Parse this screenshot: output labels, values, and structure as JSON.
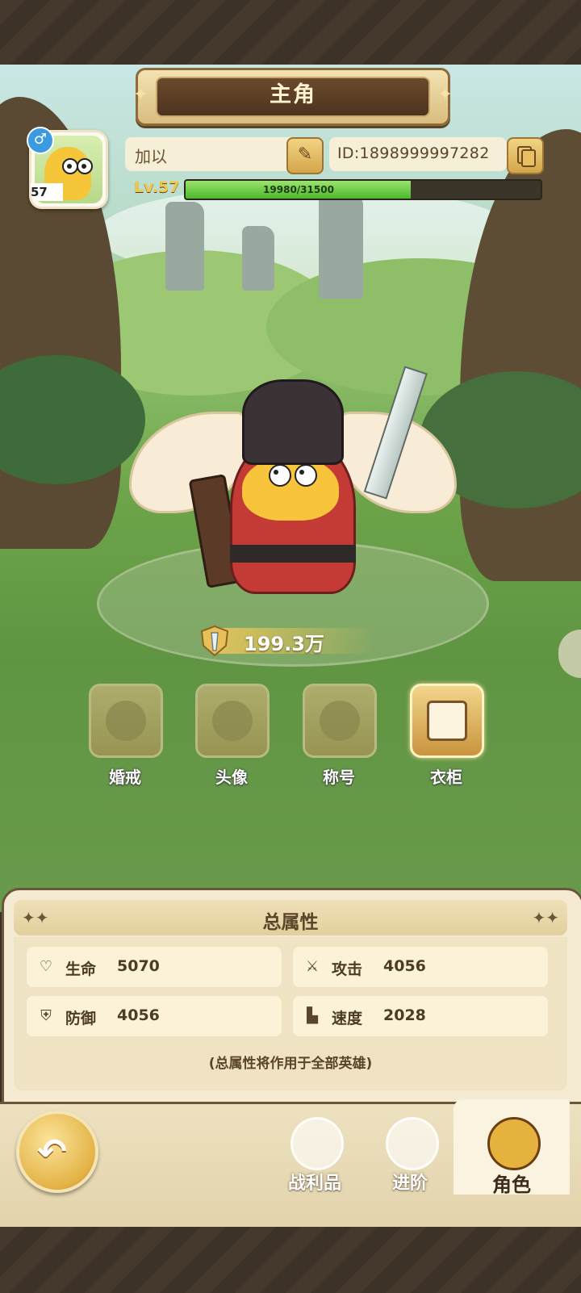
{
  "header": {
    "title": "主角"
  },
  "profile": {
    "avatar_level": "57",
    "gender_symbol": "♂",
    "name": "加以",
    "id": "ID:1898999997282",
    "level_label": "Lv.57",
    "exp_text": "19980/31500",
    "exp_fraction": 0.634
  },
  "power": {
    "value": "199.3万"
  },
  "functions": [
    {
      "label": "婚戒",
      "active": false
    },
    {
      "label": "头像",
      "active": false
    },
    {
      "label": "称号",
      "active": false
    },
    {
      "label": "衣柜",
      "active": true
    }
  ],
  "attributes": {
    "title": "总属性",
    "items": [
      {
        "label": "生命",
        "value": "5070",
        "icon": "heart-icon"
      },
      {
        "label": "攻击",
        "value": "4056",
        "icon": "attack-icon"
      },
      {
        "label": "防御",
        "value": "4056",
        "icon": "shield-icon"
      },
      {
        "label": "速度",
        "value": "2028",
        "icon": "boot-icon"
      }
    ],
    "note": "(总属性将作用于全部英雄)"
  },
  "nav": {
    "tabs": [
      {
        "label": "战利品",
        "active": false
      },
      {
        "label": "进阶",
        "active": false
      },
      {
        "label": "角色",
        "active": true
      }
    ]
  },
  "colors": {
    "accent_gold": "#e3b346",
    "exp_green": "#4bb82c",
    "panel_bg": "#f4ebd2"
  }
}
